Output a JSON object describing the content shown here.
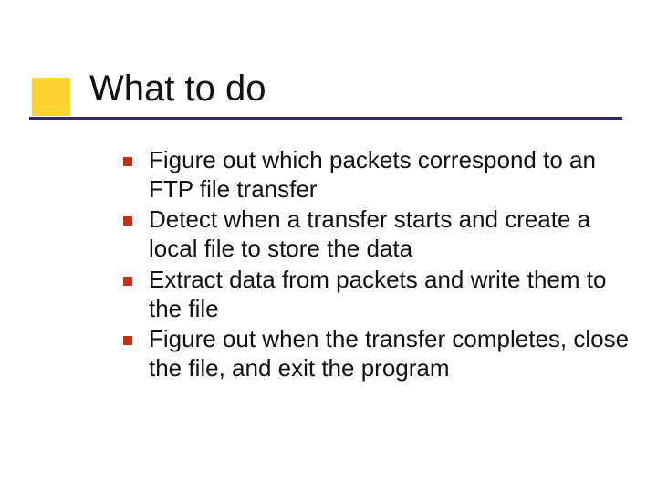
{
  "slide": {
    "title": "What to do",
    "bullets": [
      "Figure out which packets correspond to an FTP file transfer",
      "Detect when a transfer starts and create a local file to store the data",
      "Extract data from packets and write them to the file",
      "Figure out when the transfer completes, close the file, and exit the program"
    ]
  }
}
